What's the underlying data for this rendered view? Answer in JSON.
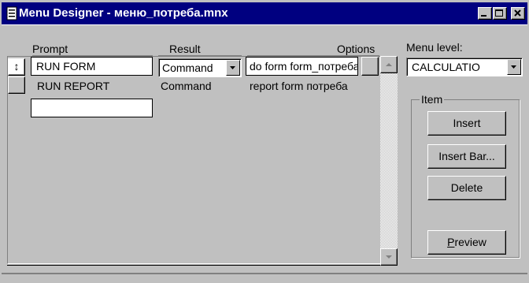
{
  "window": {
    "title": "Menu Designer - меню_потреба.mnx",
    "title_bg": "#000080",
    "title_fg": "#ffffff"
  },
  "columns": {
    "prompt": "Prompt",
    "result": "Result",
    "options": "Options"
  },
  "rows": [
    {
      "prompt": "RUN FORM",
      "result": "Command",
      "command": "do form form_потреба"
    },
    {
      "prompt": "RUN REPORT",
      "result": "Command",
      "command": "report form потреба"
    },
    {
      "prompt": "",
      "result": "",
      "command": ""
    }
  ],
  "menu_level": {
    "label": "Menu level:",
    "value": "CALCULATIO"
  },
  "item_group": {
    "label": "Item",
    "buttons": {
      "insert": "Insert",
      "insert_bar": "Insert Bar...",
      "delete": "Delete"
    }
  },
  "preview": {
    "prefix": "P",
    "rest": "review"
  },
  "icons": {
    "window": "menu-designer-icon",
    "mover": "move-updown-icon"
  }
}
